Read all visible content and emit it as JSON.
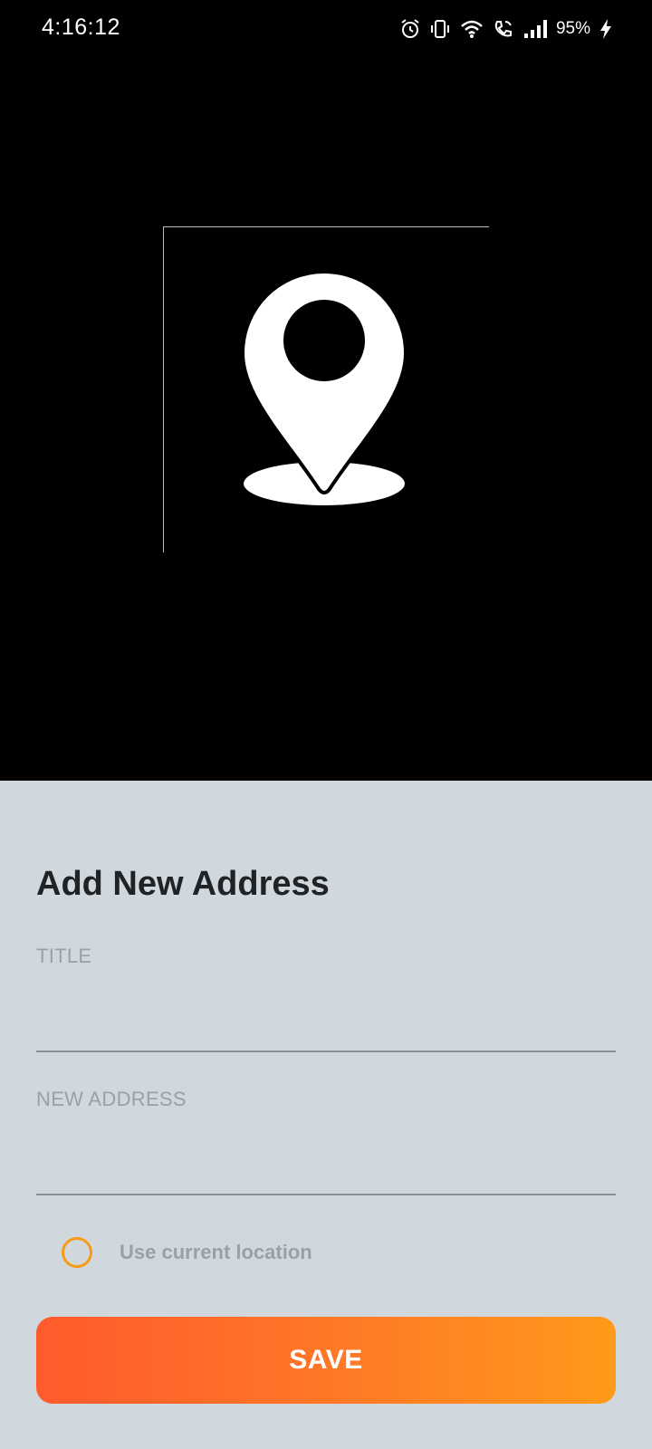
{
  "status_bar": {
    "time": "4:16:12",
    "battery": "95%",
    "icons": [
      "alarm-icon",
      "vibrate-icon",
      "wifi-icon",
      "wifi-call-icon",
      "signal-icon",
      "charging-icon"
    ]
  },
  "header_image": {
    "icon": "location-pin-icon"
  },
  "form": {
    "title": "Add New Address",
    "title_field": {
      "label": "TITLE",
      "value": ""
    },
    "address_field": {
      "label": "NEW ADDRESS",
      "value": ""
    },
    "use_current_location": {
      "label": "Use current location",
      "checked": false
    },
    "save_label": "SAVE"
  },
  "colors": {
    "accent": "#f79a16",
    "button_start": "#ff5a2c",
    "button_end": "#ff9a1a",
    "form_background": "#d1d8dd"
  }
}
